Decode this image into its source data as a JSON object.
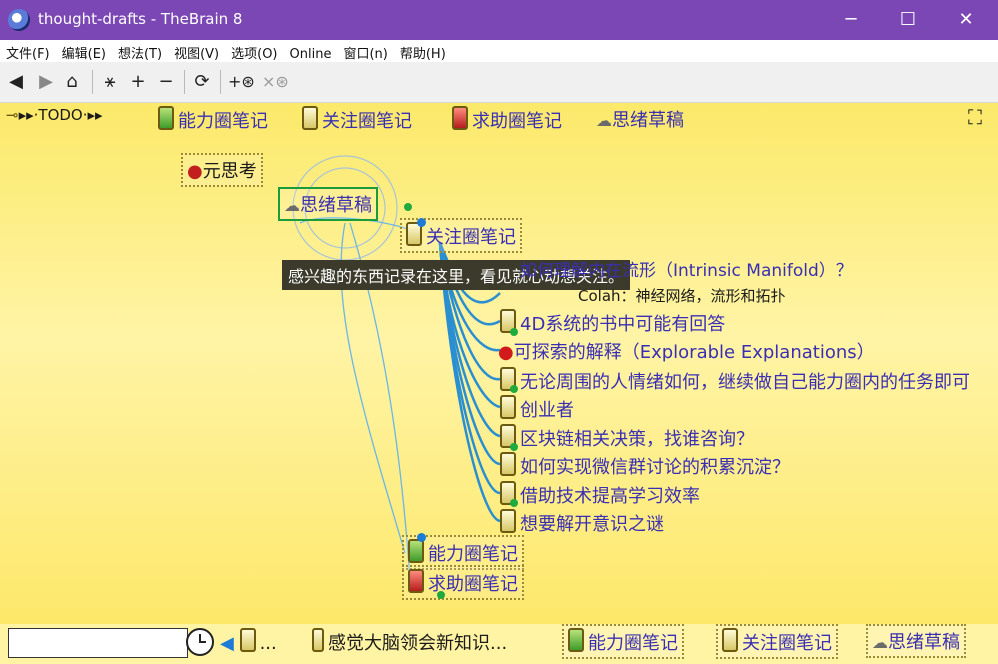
{
  "window": {
    "title": "thought-drafts - TheBrain 8",
    "minimize": "─",
    "maximize": "☐",
    "close": "✕"
  },
  "menu": [
    "文件(F)",
    "编辑(E)",
    "想法(T)",
    "视图(V)",
    "选项(O)",
    "Online",
    "窗口(n)",
    "帮助(H)"
  ],
  "toolbar": {
    "back": "◀",
    "forward": "▶",
    "home": "⌂",
    "add": "+",
    "remove": "−",
    "refresh": "⟳",
    "link_add": "+⊛",
    "link_remove": "×⊛"
  },
  "pins_top": [
    "▸▸·TODO·▸▸",
    "能力圈笔记",
    "关注圈笔记",
    "求助圈笔记",
    "思绪草稿"
  ],
  "nodes": {
    "meta": "元思考",
    "parent": "思绪草稿",
    "active": "关注圈笔记",
    "children": [
      "如何理解内在流形（Intrinsic Manifold）？",
      "Colah：神经网络，流形和拓扑",
      "4D系统的书中可能有回答",
      "可探索的解释（Explorable Explanations）",
      "无论周围的人情绪如何，继续做自己能力圈内的任务即可",
      "创业者",
      "区块链相关决策，找谁咨询？",
      "如何实现微信群讨论的积累沉淀？",
      "借助技术提高学习效率",
      "想要解开意识之谜"
    ],
    "sibling_a": "能力圈笔记",
    "sibling_b": "求助圈笔记"
  },
  "tooltip": "感兴趣的东西记录在这里，看见就心动想关注。",
  "statusbar": {
    "search_value": "",
    "history": "...",
    "current": "感觉大脑领会新知识...",
    "pins": [
      "能力圈笔记",
      "关注圈笔记",
      "思绪草稿"
    ]
  },
  "colors": {
    "titlebar": "#7b47b4",
    "canvas": "#fbe96a",
    "link_text": "#3a2fb3"
  }
}
